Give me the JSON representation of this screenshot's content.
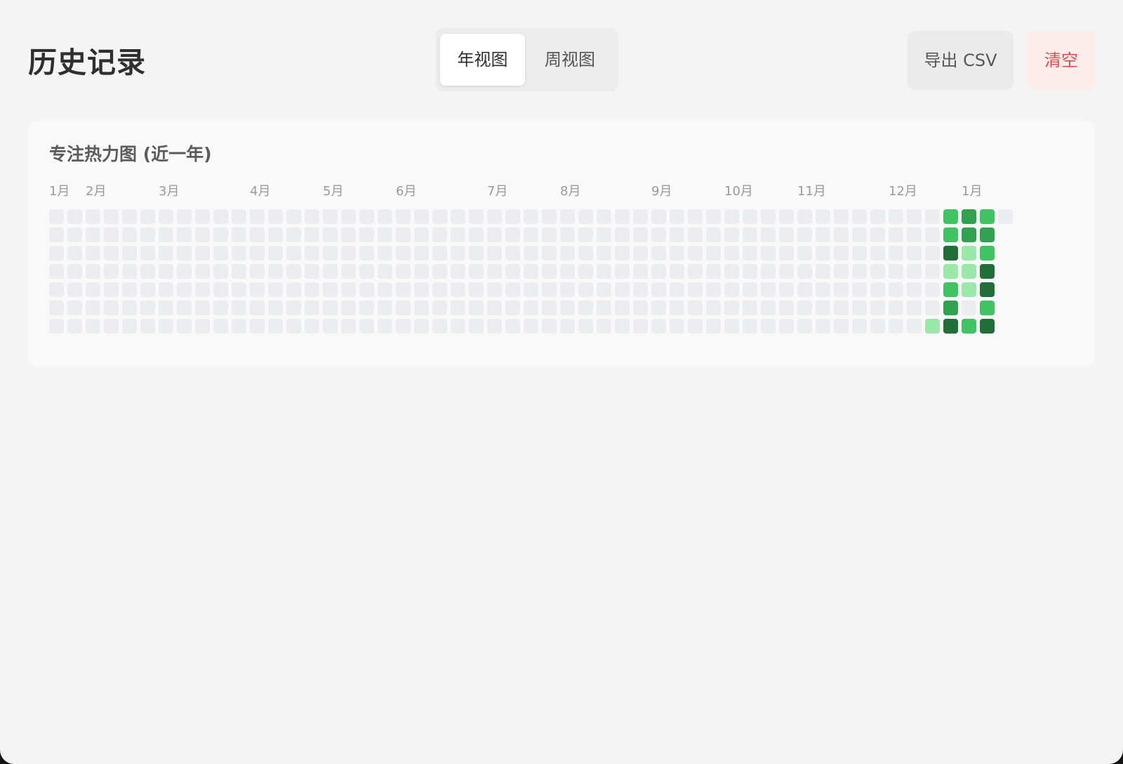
{
  "header": {
    "title": "历史记录",
    "view_tabs": [
      {
        "label": "年视图",
        "active": true
      },
      {
        "label": "周视图",
        "active": false
      }
    ],
    "export_label": "导出 CSV",
    "clear_label": "清空"
  },
  "heatmap": {
    "title": "专注热力图 (近一年)",
    "month_labels": [
      {
        "label": "1月",
        "week": 0
      },
      {
        "label": "2月",
        "week": 2
      },
      {
        "label": "3月",
        "week": 6
      },
      {
        "label": "4月",
        "week": 11
      },
      {
        "label": "5月",
        "week": 15
      },
      {
        "label": "6月",
        "week": 19
      },
      {
        "label": "7月",
        "week": 24
      },
      {
        "label": "8月",
        "week": 28
      },
      {
        "label": "9月",
        "week": 33
      },
      {
        "label": "10月",
        "week": 37
      },
      {
        "label": "11月",
        "week": 41
      },
      {
        "label": "12月",
        "week": 46
      },
      {
        "label": "1月",
        "week": 50
      }
    ],
    "colors": [
      "#ebedf0",
      "#9be9a8",
      "#40c463",
      "#30a14e",
      "#216e39"
    ],
    "weeks": 53,
    "days_per_week": 7,
    "levels": [
      [
        0,
        0,
        0,
        0,
        0,
        0,
        0
      ],
      [
        0,
        0,
        0,
        0,
        0,
        0,
        0
      ],
      [
        0,
        0,
        0,
        0,
        0,
        0,
        0
      ],
      [
        0,
        0,
        0,
        0,
        0,
        0,
        0
      ],
      [
        0,
        0,
        0,
        0,
        0,
        0,
        0
      ],
      [
        0,
        0,
        0,
        0,
        0,
        0,
        0
      ],
      [
        0,
        0,
        0,
        0,
        0,
        0,
        0
      ],
      [
        0,
        0,
        0,
        0,
        0,
        0,
        0
      ],
      [
        0,
        0,
        0,
        0,
        0,
        0,
        0
      ],
      [
        0,
        0,
        0,
        0,
        0,
        0,
        0
      ],
      [
        0,
        0,
        0,
        0,
        0,
        0,
        0
      ],
      [
        0,
        0,
        0,
        0,
        0,
        0,
        0
      ],
      [
        0,
        0,
        0,
        0,
        0,
        0,
        0
      ],
      [
        0,
        0,
        0,
        0,
        0,
        0,
        0
      ],
      [
        0,
        0,
        0,
        0,
        0,
        0,
        0
      ],
      [
        0,
        0,
        0,
        0,
        0,
        0,
        0
      ],
      [
        0,
        0,
        0,
        0,
        0,
        0,
        0
      ],
      [
        0,
        0,
        0,
        0,
        0,
        0,
        0
      ],
      [
        0,
        0,
        0,
        0,
        0,
        0,
        0
      ],
      [
        0,
        0,
        0,
        0,
        0,
        0,
        0
      ],
      [
        0,
        0,
        0,
        0,
        0,
        0,
        0
      ],
      [
        0,
        0,
        0,
        0,
        0,
        0,
        0
      ],
      [
        0,
        0,
        0,
        0,
        0,
        0,
        0
      ],
      [
        0,
        0,
        0,
        0,
        0,
        0,
        0
      ],
      [
        0,
        0,
        0,
        0,
        0,
        0,
        0
      ],
      [
        0,
        0,
        0,
        0,
        0,
        0,
        0
      ],
      [
        0,
        0,
        0,
        0,
        0,
        0,
        0
      ],
      [
        0,
        0,
        0,
        0,
        0,
        0,
        0
      ],
      [
        0,
        0,
        0,
        0,
        0,
        0,
        0
      ],
      [
        0,
        0,
        0,
        0,
        0,
        0,
        0
      ],
      [
        0,
        0,
        0,
        0,
        0,
        0,
        0
      ],
      [
        0,
        0,
        0,
        0,
        0,
        0,
        0
      ],
      [
        0,
        0,
        0,
        0,
        0,
        0,
        0
      ],
      [
        0,
        0,
        0,
        0,
        0,
        0,
        0
      ],
      [
        0,
        0,
        0,
        0,
        0,
        0,
        0
      ],
      [
        0,
        0,
        0,
        0,
        0,
        0,
        0
      ],
      [
        0,
        0,
        0,
        0,
        0,
        0,
        0
      ],
      [
        0,
        0,
        0,
        0,
        0,
        0,
        0
      ],
      [
        0,
        0,
        0,
        0,
        0,
        0,
        0
      ],
      [
        0,
        0,
        0,
        0,
        0,
        0,
        0
      ],
      [
        0,
        0,
        0,
        0,
        0,
        0,
        0
      ],
      [
        0,
        0,
        0,
        0,
        0,
        0,
        0
      ],
      [
        0,
        0,
        0,
        0,
        0,
        0,
        0
      ],
      [
        0,
        0,
        0,
        0,
        0,
        0,
        0
      ],
      [
        0,
        0,
        0,
        0,
        0,
        0,
        0
      ],
      [
        0,
        0,
        0,
        0,
        0,
        0,
        0
      ],
      [
        0,
        0,
        0,
        0,
        0,
        0,
        0
      ],
      [
        0,
        0,
        0,
        0,
        0,
        0,
        0
      ],
      [
        0,
        0,
        0,
        0,
        0,
        0,
        1
      ],
      [
        2,
        2,
        4,
        1,
        2,
        3,
        4
      ],
      [
        3,
        3,
        1,
        1,
        1,
        0,
        2
      ],
      [
        2,
        3,
        2,
        4,
        4,
        2,
        4
      ],
      [
        0
      ]
    ]
  }
}
